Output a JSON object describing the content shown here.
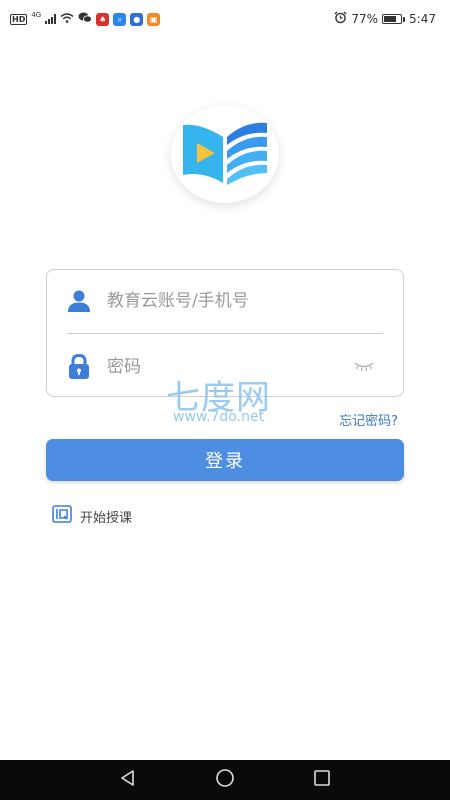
{
  "status_bar": {
    "hd": "HD",
    "network": "4G",
    "app_icons": [
      "sa-app-icon",
      "search-app-icon",
      "pin-app-icon",
      "shop-app-icon"
    ],
    "battery_level": 77,
    "battery_text": "77%",
    "time": "5:47"
  },
  "login": {
    "account_placeholder": "教育云账号/手机号",
    "password_placeholder": "密码",
    "forgot_label": "忘记密码?",
    "login_label": "登录",
    "teach_label": "开始授课"
  },
  "watermark": {
    "title": "七度网",
    "url": "www.7do.net"
  },
  "colors": {
    "accent": "#4d8ee3",
    "link": "#3a78c4",
    "icon_blue": "#3d7fd8"
  },
  "nav": {
    "icons": [
      "back-icon",
      "home-icon",
      "recent-apps-icon"
    ]
  }
}
